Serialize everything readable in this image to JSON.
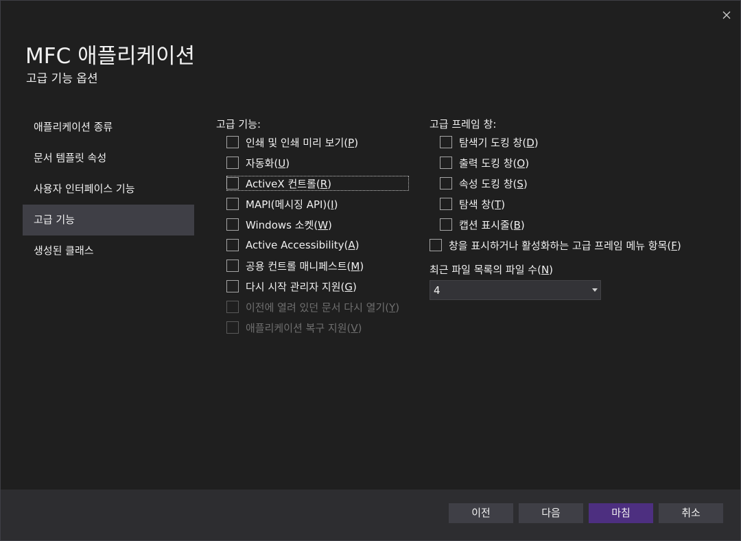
{
  "dialog": {
    "title": "MFC 애플리케이션",
    "subtitle": "고급 기능 옵션"
  },
  "nav": {
    "items": [
      {
        "label": "애플리케이션 종류",
        "selected": false
      },
      {
        "label": "문서 템플릿 속성",
        "selected": false
      },
      {
        "label": "사용자 인터페이스 기능",
        "selected": false
      },
      {
        "label": "고급 기능",
        "selected": true
      },
      {
        "label": "생성된 클래스",
        "selected": false
      }
    ]
  },
  "advanced": {
    "label": "고급 기능:",
    "options": [
      {
        "before": "인쇄 및 인쇄 미리 보기(",
        "key": "P",
        "after": ")",
        "checked": false,
        "enabled": true
      },
      {
        "before": "자동화(",
        "key": "U",
        "after": ")",
        "checked": false,
        "enabled": true
      },
      {
        "before": "ActiveX 컨트롤(",
        "key": "R",
        "after": ")",
        "checked": false,
        "enabled": true
      },
      {
        "before": "MAPI(메시징 API)(",
        "key": "I",
        "after": ")",
        "checked": false,
        "enabled": true
      },
      {
        "before": "Windows 소켓(",
        "key": "W",
        "after": ")",
        "checked": false,
        "enabled": true
      },
      {
        "before": "Active Accessibility(",
        "key": "A",
        "after": ")",
        "checked": false,
        "enabled": true
      },
      {
        "before": "공용 컨트롤 매니페스트(",
        "key": "M",
        "after": ")",
        "checked": false,
        "enabled": true
      },
      {
        "before": "다시 시작 관리자 지원(",
        "key": "G",
        "after": ")",
        "checked": false,
        "enabled": true
      },
      {
        "before": "이전에 열려 있던 문서 다시 열기(",
        "key": "Y",
        "after": ")",
        "checked": false,
        "enabled": false
      },
      {
        "before": "애플리케이션 복구 지원(",
        "key": "V",
        "after": ")",
        "checked": false,
        "enabled": false
      }
    ]
  },
  "frame_panes": {
    "label": "고급 프레임 창:",
    "options": [
      {
        "before": "탐색기 도킹 창(",
        "key": "D",
        "after": ")",
        "checked": false,
        "enabled": true
      },
      {
        "before": "출력 도킹 창(",
        "key": "O",
        "after": ")",
        "checked": false,
        "enabled": true
      },
      {
        "before": "속성 도킹 창(",
        "key": "S",
        "after": ")",
        "checked": false,
        "enabled": true
      },
      {
        "before": "탐색 창(",
        "key": "T",
        "after": ")",
        "checked": false,
        "enabled": true
      },
      {
        "before": "캡션 표시줄(",
        "key": "B",
        "after": ")",
        "checked": false,
        "enabled": true
      }
    ],
    "menu_option": {
      "before": "창을 표시하거나 활성화하는 고급 프레임 메뉴 항목(",
      "key": "F",
      "after": ")",
      "checked": false,
      "enabled": true
    }
  },
  "mru": {
    "label_before": "최근 파일 목록의 파일 수(",
    "label_key": "N",
    "label_after": ")",
    "value": "4"
  },
  "footer": {
    "prev": "이전",
    "next": "다음",
    "finish": "마침",
    "cancel": "취소",
    "accent_color": "#4d2f80"
  },
  "icons": {
    "close": "close-icon",
    "dropdown": "chevron-down-icon"
  }
}
